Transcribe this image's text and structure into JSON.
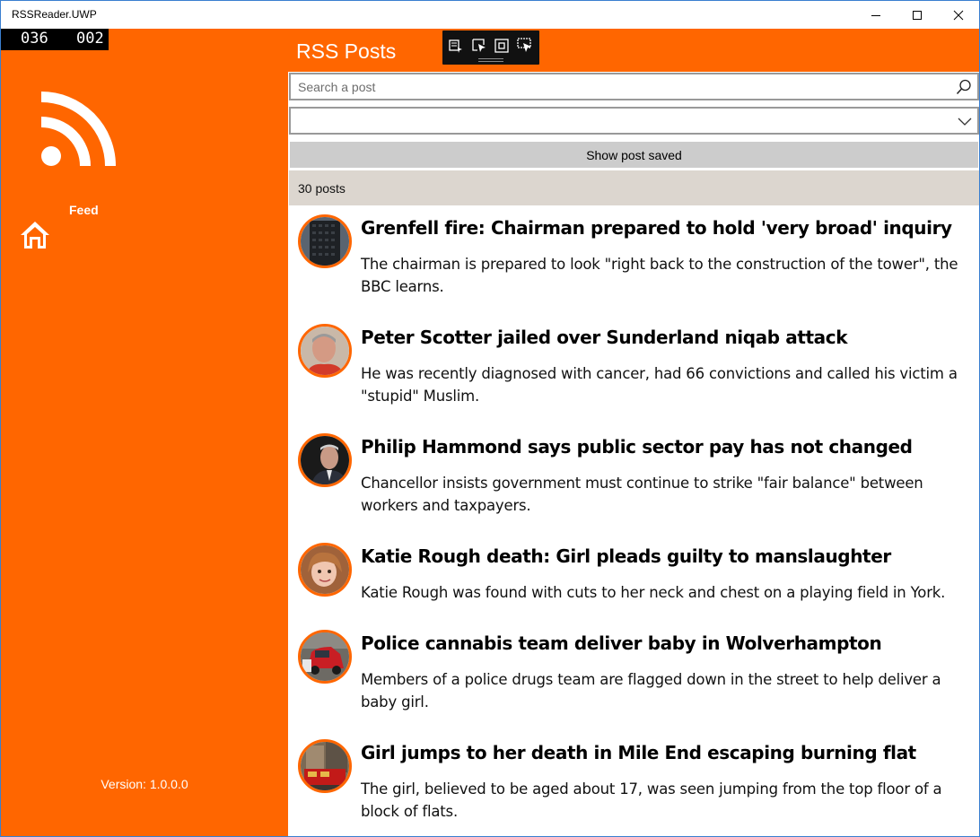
{
  "window": {
    "title": "RSSReader.UWP"
  },
  "counter": {
    "left": "036",
    "right": "002"
  },
  "nav": {
    "feed_label": "Feed",
    "version": "Version: 1.0.0.0"
  },
  "header": {
    "title": "RSS Posts"
  },
  "search": {
    "placeholder": "Search a post",
    "value": ""
  },
  "dropdown": {
    "selected": ""
  },
  "saved_button": {
    "label": "Show post saved"
  },
  "posts_count": "30 posts",
  "posts": [
    {
      "title": "Grenfell fire: Chairman prepared to hold 'very broad' inquiry",
      "description": "The chairman is prepared to look \"right back to the construction of the tower\", the BBC learns."
    },
    {
      "title": "Peter Scotter jailed over Sunderland niqab attack",
      "description": "He was recently diagnosed with cancer, had 66 convictions and called his victim a \"stupid\" Muslim."
    },
    {
      "title": "Philip Hammond says public sector pay has not changed",
      "description": "Chancellor insists government must continue to strike \"fair balance\" between workers and taxpayers."
    },
    {
      "title": "Katie Rough death: Girl pleads guilty to manslaughter",
      "description": "Katie Rough was found with cuts to her neck and chest on a playing field in York."
    },
    {
      "title": "Police cannabis team deliver baby in Wolverhampton",
      "description": "Members of a police drugs team are flagged down in the street to help deliver a baby girl."
    },
    {
      "title": "Girl jumps to her death in Mile End escaping burning flat",
      "description": "The girl, believed to be aged about 17, was seen jumping from the top floor of a block of flats."
    }
  ],
  "colors": {
    "accent": "#ff6600",
    "count_bar": "#dcd6cf",
    "saved_button_bg": "#cccccc"
  },
  "icons": {
    "logo": "rss-icon",
    "nav": "home-icon",
    "search": "search-icon",
    "dropdown": "chevron-down-icon"
  }
}
